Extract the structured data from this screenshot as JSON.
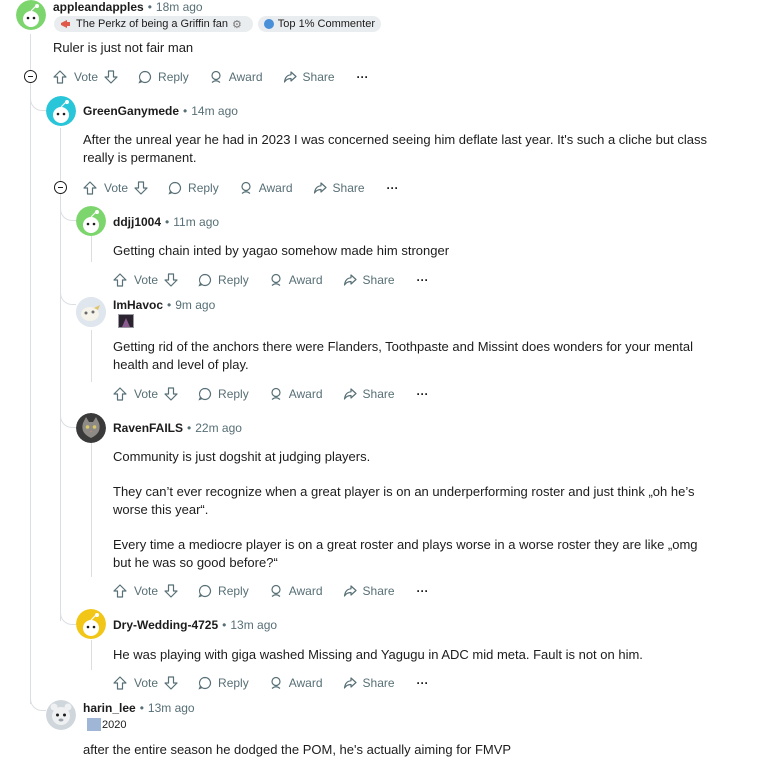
{
  "actions": {
    "vote": "Vote",
    "reply": "Reply",
    "award": "Award",
    "share": "Share",
    "more": "···"
  },
  "comments": {
    "c1": {
      "author": "appleandapples",
      "time": "18m ago",
      "flair_1": "The Perkz of being a Griffin fan",
      "flair_2": "Top 1% Commenter",
      "body": [
        "Ruler is just not fair man"
      ]
    },
    "c2": {
      "author": "GreenGanymede",
      "time": "14m ago",
      "body": [
        "After the unreal year he had in 2023 I was concerned seeing him deflate last year. It's such a cliche but class really is permanent."
      ]
    },
    "c3": {
      "author": "ddjj1004",
      "time": "11m ago",
      "body": [
        "Getting chain inted by yagao somehow made him stronger"
      ]
    },
    "c4": {
      "author": "ImHavoc",
      "time": "9m ago",
      "body": [
        "Getting rid of the anchors there were Flanders, Toothpaste and Missint does wonders for your mental health and level of play."
      ]
    },
    "c5": {
      "author": "RavenFAILS",
      "time": "22m ago",
      "body": [
        "Community is just dogshit at judging players.",
        "They can’t ever recognize when a great player is on an underperforming roster and just think „oh he’s worse this year“.",
        "Every time a mediocre player is on a great roster and plays worse in a worse roster they are like „omg but he was so good before?“"
      ]
    },
    "c6": {
      "author": "Dry-Wedding-4725",
      "time": "13m ago",
      "body": [
        "He was playing with giga washed Missing and Yagugu in ADC mid meta. Fault is not on him."
      ]
    },
    "c7": {
      "author": "harin_lee",
      "time": "13m ago",
      "flair": "2020",
      "body": [
        "after the entire season he dodged the POM, he's actually aiming for FMVP"
      ]
    }
  }
}
